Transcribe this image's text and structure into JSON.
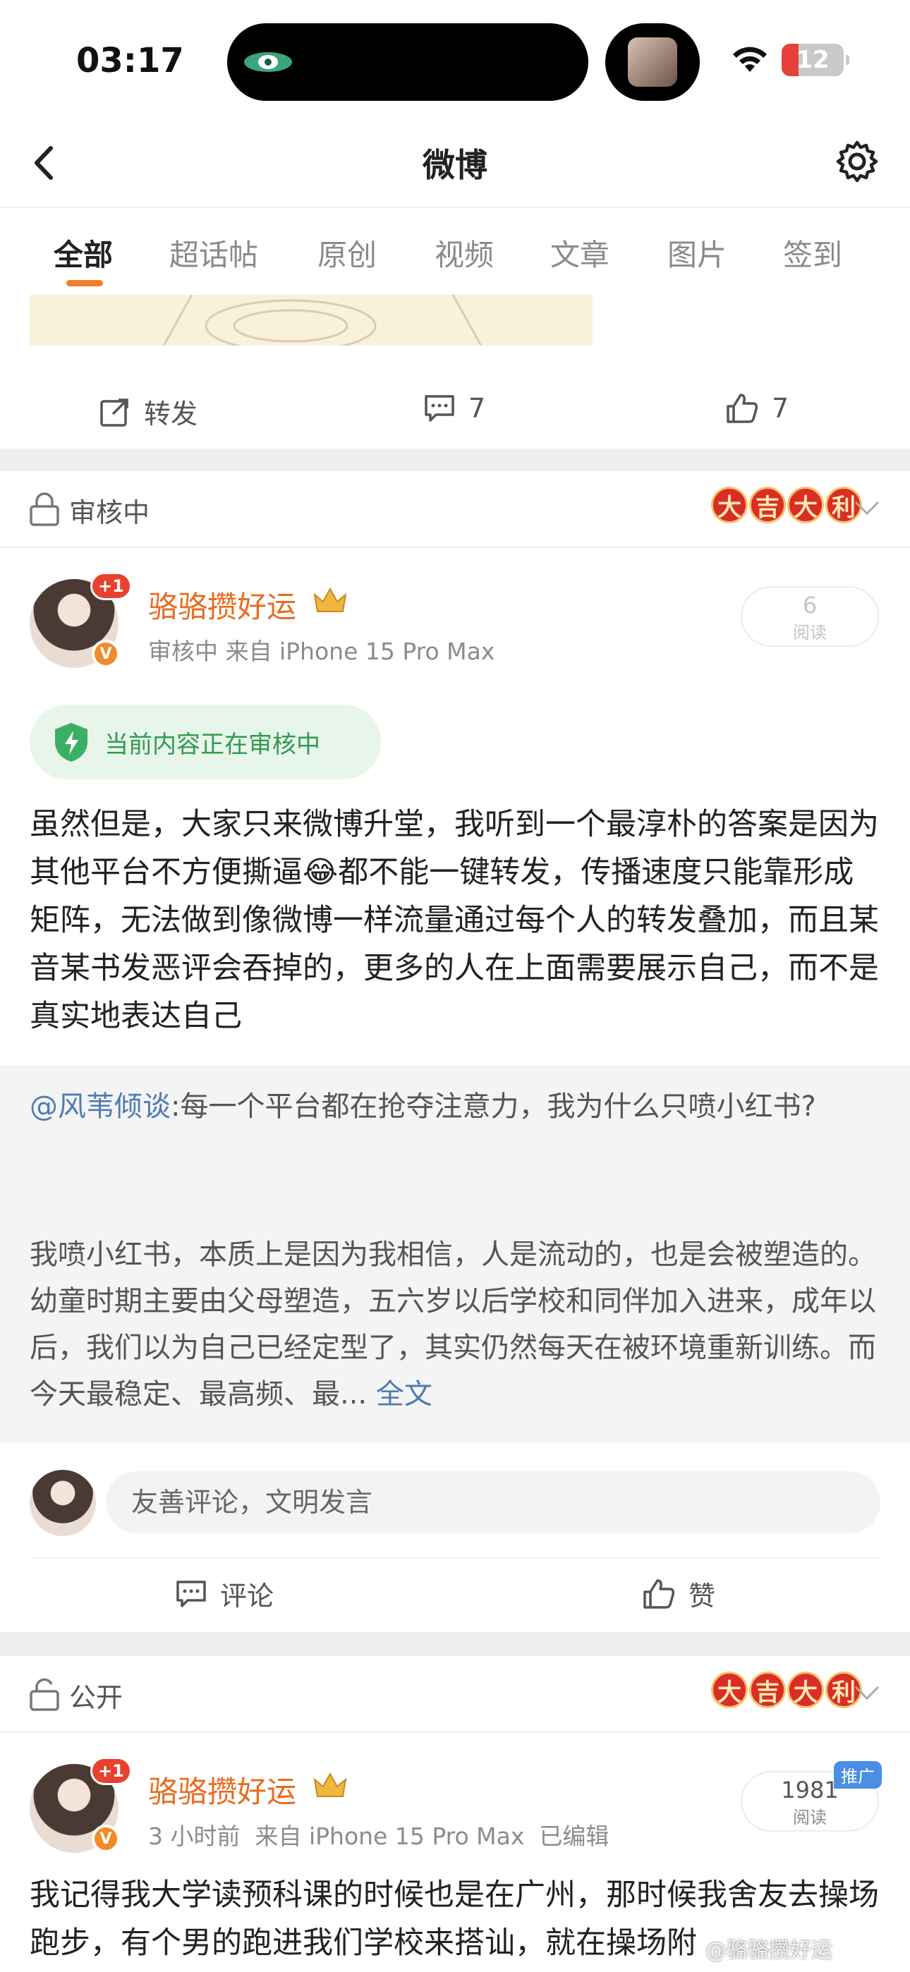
{
  "status_bar": {
    "time": "03:17",
    "battery": "12"
  },
  "header": {
    "title": "微博"
  },
  "tabs": [
    "全部",
    "超话帖",
    "原创",
    "视频",
    "文章",
    "图片",
    "签到"
  ],
  "post1_actions": {
    "repost": "转发",
    "comments": "7",
    "likes": "7"
  },
  "fortune_chars": [
    "大",
    "吉",
    "大",
    "利"
  ],
  "post2": {
    "visibility": "审核中",
    "username": "骆骆攒好运",
    "plus_badge": "+1",
    "meta": "审核中 来自 iPhone 15 Pro Max",
    "reads_count": "6",
    "reads_label": "阅读",
    "review_notice": "当前内容正在审核中",
    "body": "虽然但是，大家只来微博升堂，我听到一个最淳朴的答案是因为其他平台不方便撕逼😂都不能一键转发，传播速度只能靠形成矩阵，无法做到像微博一样流量通过每个人的转发叠加，而且某音某书发恶评会吞掉的，更多的人在上面需要展示自己，而不是真实地表达自己",
    "quote_mention": "@风苇倾谈",
    "quote_line1": ":每一个平台都在抢夺注意力，我为什么只喷小红书?",
    "quote_para2": "我喷小红书，本质上是因为我相信，人是流动的，也是会被塑造的。幼童时期主要由父母塑造，五六岁以后学校和同伴加入进来，成年以后，我们以为自己已经定型了，其实仍然每天在被环境重新训练。而今天最稳定、最高频、最...",
    "quote_more": "全文",
    "comment_placeholder": "友善评论，文明发言",
    "comment_label": "评论",
    "like_label": "赞"
  },
  "post3": {
    "visibility": "公开",
    "username": "骆骆攒好运",
    "plus_badge": "+1",
    "meta": "3 小时前  来自 iPhone 15 Pro Max  已编辑",
    "reads_count": "1981",
    "reads_label": "阅读",
    "promo": "推广",
    "body": "我记得我大学读预科课的时候也是在广州，那时候我舍友去操场跑步，有个男的跑进我们学校来搭讪，就在操场附"
  },
  "watermark": "@骆骆攒好运",
  "colors": {
    "accent": "#f27e2a",
    "username": "#e86b1f",
    "link": "#4f7bb3",
    "review_green": "#2f9c4f"
  }
}
